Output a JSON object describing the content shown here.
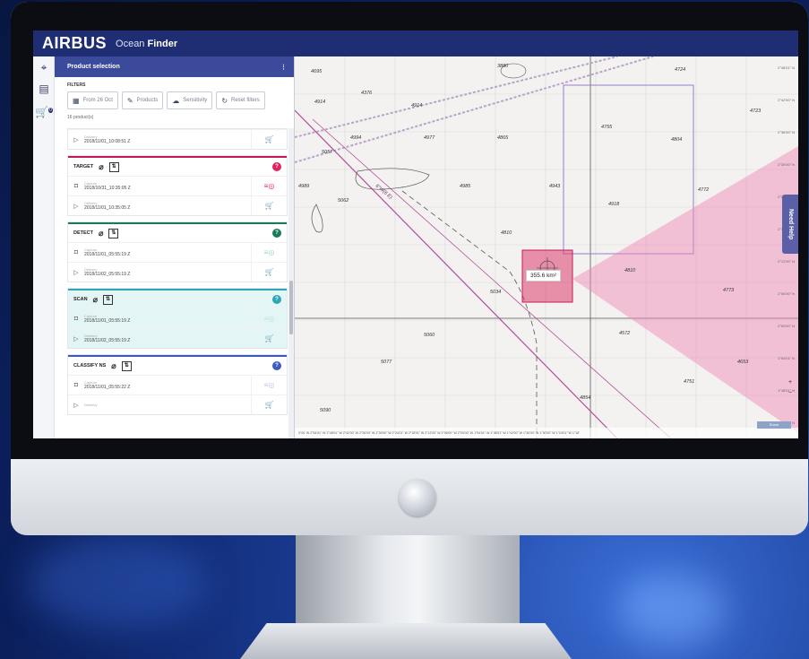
{
  "brand": {
    "logo": "AIRBUS",
    "app_prefix": "Ocean ",
    "app_name": "Finder"
  },
  "rail": {
    "icons": [
      "crosshair-icon",
      "document-icon",
      "cart-icon"
    ],
    "cart_badge": "0"
  },
  "panel": {
    "title": "Product selection",
    "menu_glyph": "⋮",
    "filters_label": "FILTERS",
    "filters": [
      {
        "icon": "calendar-icon",
        "glyph": "▦",
        "label": "From 26 Oct"
      },
      {
        "icon": "pencil-icon",
        "glyph": "✎",
        "label": "Products"
      },
      {
        "icon": "cloud-icon",
        "glyph": "☁",
        "label": "Sensitivity"
      },
      {
        "icon": "reset-icon",
        "glyph": "↻",
        "label": "Reset filters"
      }
    ],
    "count": "16 product(s)"
  },
  "cards": [
    {
      "name": "",
      "color": "#cccccc",
      "help_color": "#cccccc",
      "rows": [
        {
          "label": "Delivery",
          "date": "2018/11/01_10:08:51 Z",
          "icon": "▷",
          "action": "🛒",
          "action_color": "#9c3f8f"
        }
      ]
    },
    {
      "name": "TARGET",
      "color": "#c2185b",
      "help_color": "#e0245e",
      "rows": [
        {
          "label": "Capture",
          "date": "2018/10/31_10:35:05 Z",
          "icon": "◘",
          "action": "≡◎",
          "action_color": "#e0245e"
        },
        {
          "label": "Delivery",
          "date": "2018/11/01_10:35:05 Z",
          "icon": "▷",
          "action": "🛒",
          "action_color": "#e0245e"
        }
      ]
    },
    {
      "name": "DETECT",
      "color": "#1b7a5a",
      "help_color": "#1b7a5a",
      "rows": [
        {
          "label": "Capture",
          "date": "2018/11/01_05:55:19 Z",
          "icon": "◘",
          "action": "≡◎",
          "action_color": "#9ad8b6"
        },
        {
          "label": "Delivery",
          "date": "2018/11/02_05:55:19 Z",
          "icon": "▷",
          "action": "🛒",
          "action_color": "#1b7a5a"
        }
      ]
    },
    {
      "name": "SCAN",
      "color": "#2aa7b3",
      "help_color": "#2aa7b3",
      "rows": [
        {
          "label": "Capture",
          "date": "2018/11/01_05:55:19 Z",
          "icon": "◘",
          "action": "≡◎",
          "action_color": "#b6e3e7"
        },
        {
          "label": "Delivery",
          "date": "2018/11/02_05:55:19 Z",
          "icon": "▷",
          "action": "🛒",
          "action_color": "#2aa7b3"
        }
      ]
    },
    {
      "name": "CLASSIFY NS",
      "color": "#3d5bbf",
      "help_color": "#3d5bbf",
      "rows": [
        {
          "label": "Capture",
          "date": "2018/11/01_05:55:22 Z",
          "icon": "◘",
          "action": "≡◎",
          "action_color": "#b9c4ea"
        },
        {
          "label": "Delivery",
          "date": "",
          "icon": "▷",
          "action": "🛒",
          "action_color": "#3d5bbf"
        }
      ]
    }
  ],
  "map": {
    "area_label": "355.6 km²",
    "route_label": "6°W(6 E)",
    "depths": [
      "4695",
      "3880",
      "4724",
      "4376",
      "4914",
      "4914",
      "4723",
      "4755",
      "4804",
      "4994",
      "4977",
      "4865",
      "5057",
      "4989",
      "4985",
      "4943",
      "4772",
      "5062",
      "4918",
      "4810",
      "4810",
      "4773",
      "5034",
      "5060",
      "4572",
      "5077",
      "4653",
      "4751",
      "4854",
      "5090"
    ],
    "latitudes": [
      "2°48'01\" N",
      "2°42'00\" N",
      "2°36'00\" N",
      "2°30'00\" N",
      "2°24'01\" N",
      "2°18'00\" N",
      "2°12'00\" N",
      "2°06'00\" N",
      "2°00'00\" N",
      "1°54'01\" N",
      "1°48'01\" N",
      "1°42'00\" N"
    ],
    "longitudes": "3°00' W   2°54'01\" W   2°48'01\" W   2°42'00\" W   2°36'00\" W   2°30'00\" W   2°24'01\" W   2°18'01\" W   2°12'00\" W   2°06'00\" W   2°00'00\" W   1°54'01\" W   1°48'01\" W   1°42'00\" W   1°36'00\" W   1°30'00\" W   1°24'01\" W   1°18'",
    "help_tab": "Need Help",
    "zoom_in": "+",
    "zoom_out": "−",
    "share": "Share"
  }
}
